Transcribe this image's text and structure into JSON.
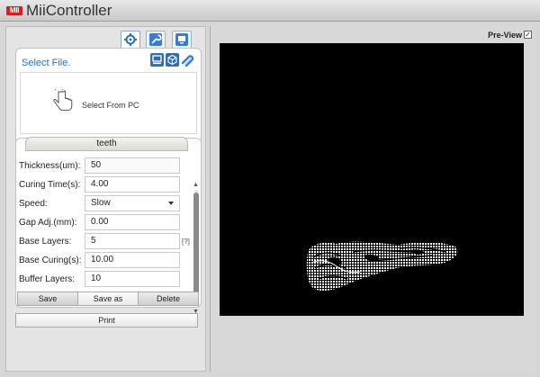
{
  "app": {
    "logo": "MII",
    "title": "MiiController"
  },
  "tabs": [
    {
      "icon": "gear-icon",
      "active": true
    },
    {
      "icon": "wrench-icon",
      "active": false
    },
    {
      "icon": "info-icon",
      "active": false
    }
  ],
  "file": {
    "label": "Select File.",
    "icons": [
      "computer-icon",
      "cube-icon",
      "link-icon"
    ],
    "pc_label": "Select From PC"
  },
  "profile": {
    "name": "teeth"
  },
  "params": {
    "thickness": {
      "label": "Thickness(um):",
      "value": "50"
    },
    "curing_time": {
      "label": "Curing Time(s):",
      "value": "4.00"
    },
    "speed": {
      "label": "Speed:",
      "value": "Slow"
    },
    "gap_adj": {
      "label": "Gap Adj.(mm):",
      "value": "0.00"
    },
    "base_layers": {
      "label": "Base Layers:",
      "value": "5",
      "help": "[?]"
    },
    "base_curing": {
      "label": "Base Curing(s):",
      "value": "10.00"
    },
    "buffer_layers": {
      "label": "Buffer Layers:",
      "value": "10"
    }
  },
  "buttons": {
    "save": "Save",
    "save_as": "Save as",
    "delete": "Delete",
    "print": "Print"
  },
  "preview": {
    "label": "Pre-View",
    "checked": "✓"
  },
  "colors": {
    "accent": "#2a6fc4",
    "logo": "#d42020",
    "canvas": "#000000"
  }
}
